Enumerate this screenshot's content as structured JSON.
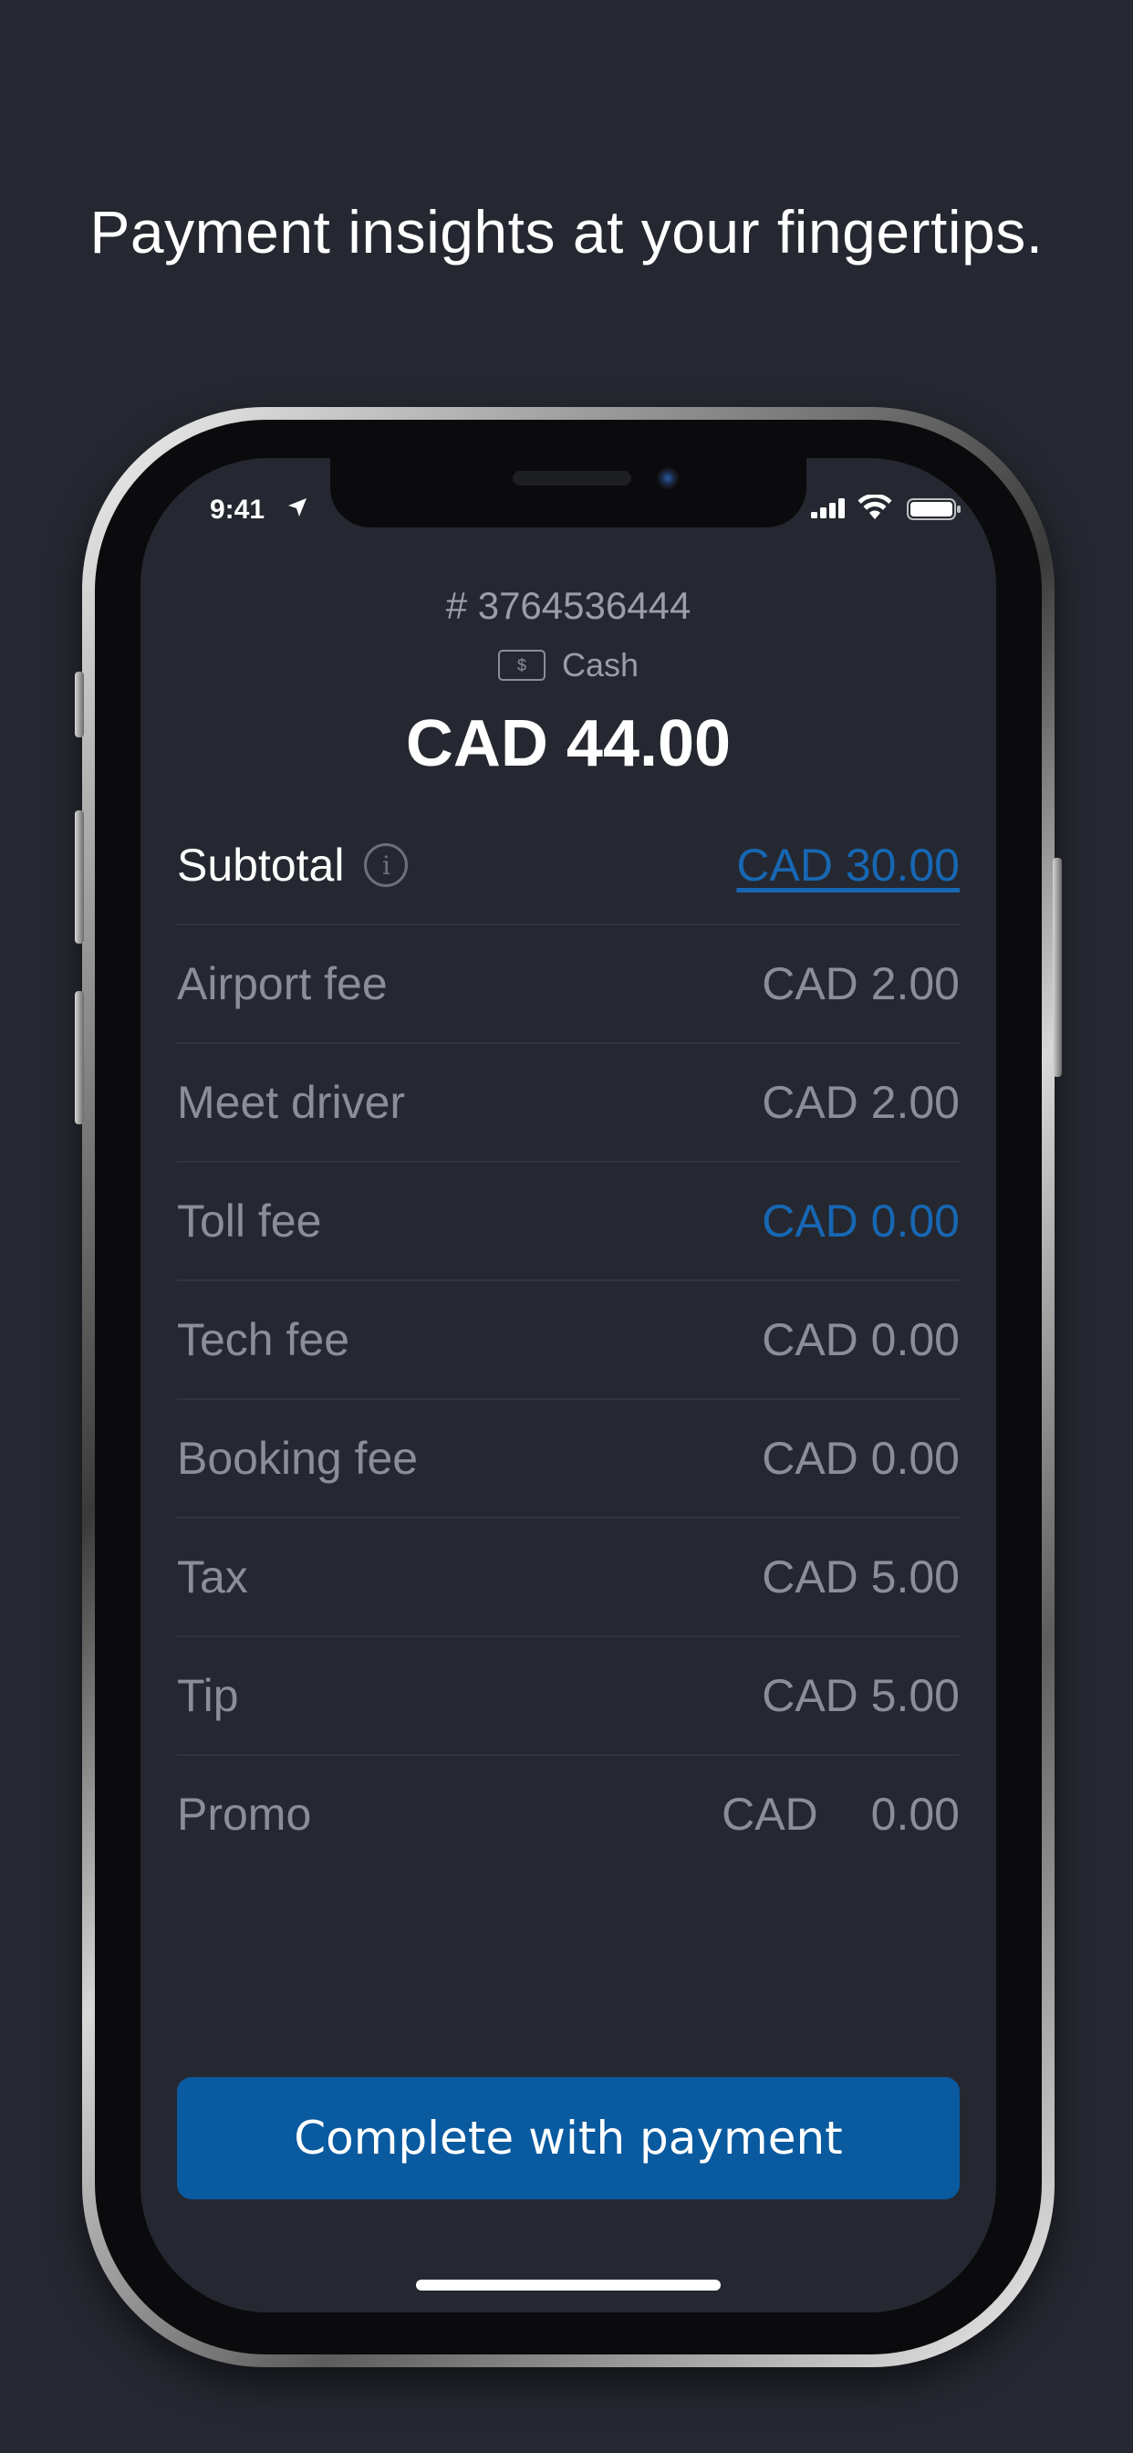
{
  "headline": "Payment insights at your fingertips.",
  "status_bar": {
    "time": "9:41",
    "location_icon": "location-arrow-icon",
    "signal_icon": "cellular-signal-icon",
    "wifi_icon": "wifi-icon",
    "battery_icon": "battery-icon"
  },
  "order": {
    "number": "# 3764536444",
    "payment_method": "Cash",
    "payment_icon_glyph": "$",
    "total": "CAD 44.00"
  },
  "fees": {
    "subtotal": {
      "label": "Subtotal",
      "value": "CAD 30.00"
    },
    "airport": {
      "label": "Airport fee",
      "value": "CAD 2.00"
    },
    "meet_driver": {
      "label": "Meet driver",
      "value": "CAD 2.00"
    },
    "toll": {
      "label": "Toll fee",
      "value": "CAD 0.00"
    },
    "tech": {
      "label": "Tech fee",
      "value": "CAD 0.00"
    },
    "booking": {
      "label": "Booking fee",
      "value": "CAD 0.00"
    },
    "tax": {
      "label": "Tax",
      "value": "CAD 5.00"
    },
    "tip": {
      "label": "Tip",
      "value": "CAD 5.00"
    },
    "promo": {
      "label": "Promo",
      "currency": "CAD",
      "amount": "0.00"
    }
  },
  "actions": {
    "complete_label": "Complete with payment"
  },
  "colors": {
    "background": "#252830",
    "accent": "#0a5aa0",
    "link": "#1767b3",
    "muted_text": "#8a8e96"
  }
}
